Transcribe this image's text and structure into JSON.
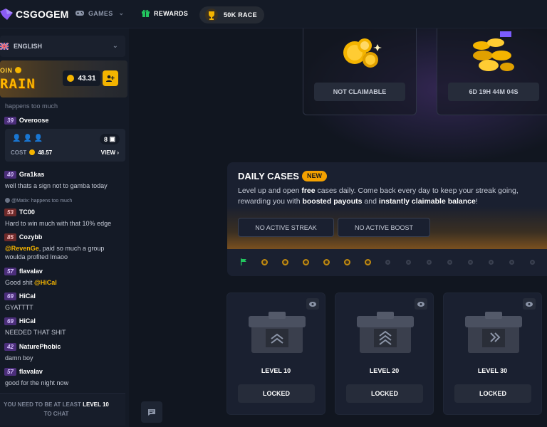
{
  "header": {
    "logo_text": "CSGOGEM",
    "nav": {
      "games": "GAMES",
      "rewards": "REWARDS",
      "race": "50K RACE"
    }
  },
  "sidebar": {
    "language": "ENGLISH",
    "rain": {
      "coin_label": "OIN",
      "title": "RAIN",
      "amount": "43.31"
    },
    "battle": {
      "count": "8",
      "cost_label": "COST",
      "cost": "48.57",
      "view_label": "VIEW"
    },
    "faded_message": "happens too much",
    "messages": [
      {
        "level": "39",
        "user": "Overoose",
        "text": ""
      },
      {
        "level": "40",
        "user": "Gra1kas",
        "text": "well thats a sign not to gamba today"
      },
      {
        "reply": "@Matix: happens too much",
        "level": "53",
        "user": "TC00",
        "text": "Hard to win much with that 10% edge"
      },
      {
        "level": "85",
        "user": "Cozybb",
        "mention": "@RevenGe",
        "text": ", paid so much a group",
        "text2": "woulda profited lmaoo"
      },
      {
        "level": "57",
        "user": "flavalav",
        "text": "Good shit ",
        "mention": "@HiCal"
      },
      {
        "level": "69",
        "user": "HiCal",
        "text": "GYATTTT"
      },
      {
        "level": "69",
        "user": "HiCal",
        "text": "NEEDED THAT SHIT"
      },
      {
        "level": "42",
        "user": "NaturePhobic",
        "text": "damn boy"
      },
      {
        "level": "57",
        "user": "flavalav",
        "text": "good for the night now"
      }
    ],
    "chat_footer": {
      "line1_prefix": "YOU NEED TO BE AT LEAST ",
      "line1_level": "LEVEL 10",
      "line2": "TO CHAT"
    }
  },
  "top_cards": [
    {
      "button": "NOT CLAIMABLE"
    },
    {
      "button": "6D 19H 44M 04S"
    }
  ],
  "daily_cases": {
    "title": "DAILY CASES",
    "badge": "NEW",
    "desc_1": "Level up and open ",
    "desc_free": "free",
    "desc_2": " cases daily. Come back every day to keep your streak going, rewarding you with ",
    "desc_boosted": "boosted payouts",
    "desc_3": " and ",
    "desc_instant": "instantly claimable balance",
    "desc_4": "!",
    "streak_button": "NO ACTIVE STREAK",
    "boost_button": "NO ACTIVE BOOST"
  },
  "cases": [
    {
      "level": "LEVEL 10",
      "status": "LOCKED"
    },
    {
      "level": "LEVEL 20",
      "status": "LOCKED"
    },
    {
      "level": "LEVEL 30",
      "status": "LOCKED"
    }
  ],
  "colors": {
    "accent": "#f4b400",
    "background": "#111620",
    "panel": "#1a2030",
    "level_badge": "#4b2e7a"
  }
}
